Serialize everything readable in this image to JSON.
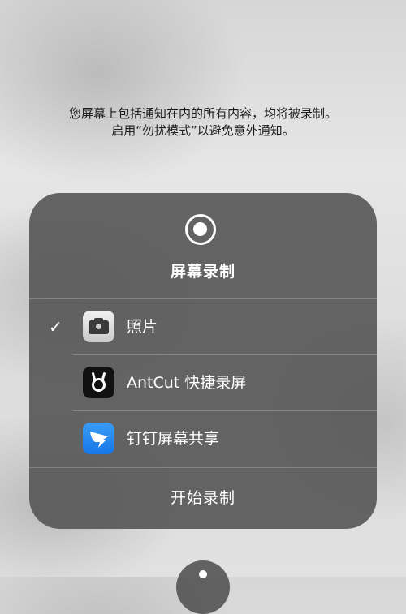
{
  "notice": {
    "line1": "您屏幕上包括通知在内的所有内容，均将被录制。",
    "line2": "启用“勿扰模式”以避免意外通知。"
  },
  "panel": {
    "title": "屏幕录制",
    "header_icon": "record-icon",
    "apps": [
      {
        "name": "照片",
        "icon": "camera-icon",
        "selected": true,
        "check": "✓"
      },
      {
        "name": "AntCut 快捷录屏",
        "icon": "antcut-icon",
        "selected": false,
        "check": ""
      },
      {
        "name": "钉钉屏幕共享",
        "icon": "dingtalk-icon",
        "selected": false,
        "check": ""
      }
    ],
    "start_label": "开始录制"
  },
  "colors": {
    "panel_bg": "#585858",
    "text": "#ffffff",
    "dingtalk_blue": "#1677e8"
  }
}
